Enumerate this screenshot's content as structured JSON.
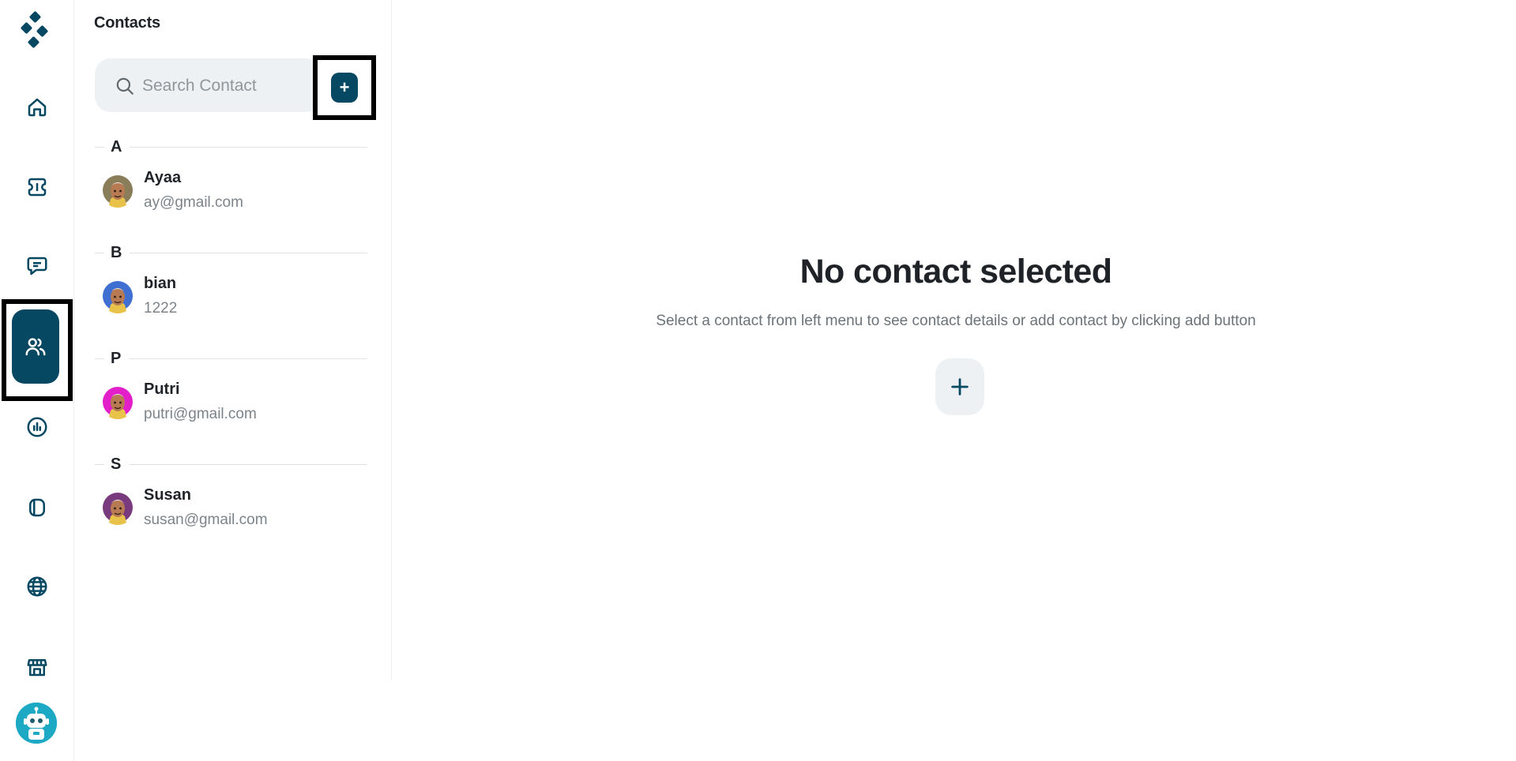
{
  "brand": {
    "accent": "#064862",
    "rail_highlight_color": "#064862"
  },
  "rail": {
    "items": [
      {
        "icon": "home-icon"
      },
      {
        "icon": "ticket-icon"
      },
      {
        "icon": "chat-icon"
      },
      {
        "icon": "contacts-icon",
        "active": true
      },
      {
        "icon": "analytics-icon"
      },
      {
        "icon": "device-icon"
      },
      {
        "icon": "globe-icon"
      },
      {
        "icon": "store-icon"
      }
    ],
    "bot_avatar_icon": "robot-icon"
  },
  "contacts_panel": {
    "title": "Contacts",
    "search": {
      "placeholder": "Search Contact",
      "value": ""
    },
    "add_button_label": "+",
    "sections": [
      {
        "letter": "A",
        "contacts": [
          {
            "name": "Ayaa",
            "detail": "ay@gmail.com",
            "avatar_bg": "#8a7d5a"
          }
        ]
      },
      {
        "letter": "B",
        "contacts": [
          {
            "name": "bian",
            "detail": "1222",
            "avatar_bg": "#3f6fd0"
          }
        ]
      },
      {
        "letter": "P",
        "contacts": [
          {
            "name": "Putri",
            "detail": "putri@gmail.com",
            "avatar_bg": "#e21fc9"
          }
        ]
      },
      {
        "letter": "S",
        "contacts": [
          {
            "name": "Susan",
            "detail": "susan@gmail.com",
            "avatar_bg": "#7a3a7e"
          }
        ]
      }
    ]
  },
  "empty_state": {
    "title": "No contact selected",
    "subtitle": "Select a contact from left menu to see contact details or add contact by clicking add button",
    "add_icon": "plus-icon"
  }
}
